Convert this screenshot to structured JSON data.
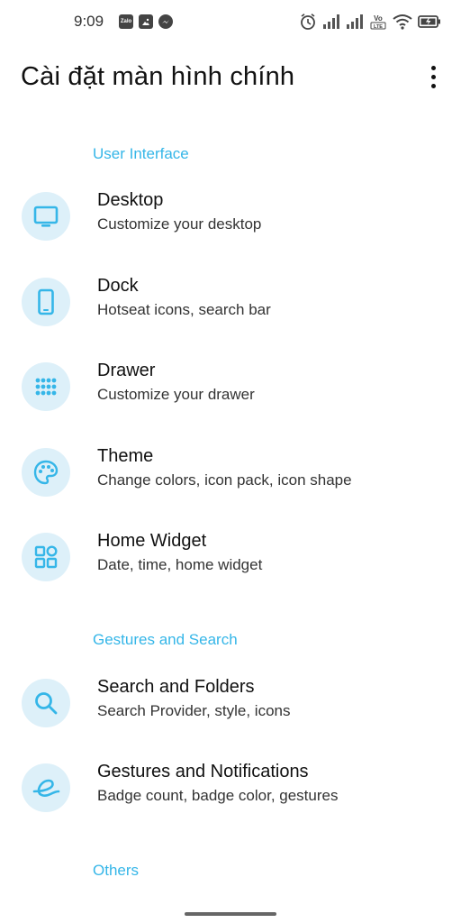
{
  "status_bar": {
    "time": "9:09",
    "notification_icons": [
      {
        "icon": "zalo-icon",
        "text": "Zalo"
      },
      {
        "icon": "gallery-icon",
        "text": ""
      },
      {
        "icon": "messenger-icon",
        "text": ""
      }
    ],
    "system_icons": [
      "alarm-icon",
      "signal-icon",
      "signal-icon",
      "volte-icon",
      "wifi-icon",
      "battery-charging-icon"
    ],
    "volte_label": "Vo LTE"
  },
  "header": {
    "title": "Cài đặt màn hình chính",
    "menu_icon": "more-vertical-icon"
  },
  "accent_color": "#35b6e8",
  "icon_background": "#ddf0f9",
  "sections": [
    {
      "header": "User Interface",
      "items": [
        {
          "title": "Desktop",
          "summary": "Customize your desktop",
          "icon": "desktop-icon"
        },
        {
          "title": "Dock",
          "summary": "Hotseat icons, search bar",
          "icon": "phone-icon"
        },
        {
          "title": "Drawer",
          "summary": "Customize your drawer",
          "icon": "app-grid-icon"
        },
        {
          "title": "Theme",
          "summary": "Change colors, icon pack, icon shape",
          "icon": "palette-icon"
        },
        {
          "title": "Home Widget",
          "summary": "Date, time, home widget",
          "icon": "widgets-icon"
        }
      ]
    },
    {
      "header": "Gestures and Search",
      "items": [
        {
          "title": "Search and Folders",
          "summary": "Search Provider, style, icons",
          "icon": "search-icon"
        },
        {
          "title": "Gestures and Notifications",
          "summary": "Badge count, badge color, gestures",
          "icon": "gesture-icon"
        }
      ]
    },
    {
      "header": "Others",
      "items": []
    }
  ]
}
